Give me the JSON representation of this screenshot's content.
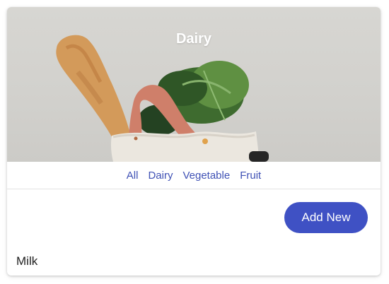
{
  "hero": {
    "title": "Dairy",
    "image": "grocery-bag-with-bread-and-greens"
  },
  "tabs": [
    {
      "label": "All"
    },
    {
      "label": "Dairy"
    },
    {
      "label": "Vegetable"
    },
    {
      "label": "Fruit"
    }
  ],
  "actions": {
    "add_label": "Add New"
  },
  "items": [
    {
      "name": "Milk"
    }
  ],
  "colors": {
    "accent": "#3f51c4",
    "tab_text": "#3f51b5"
  }
}
